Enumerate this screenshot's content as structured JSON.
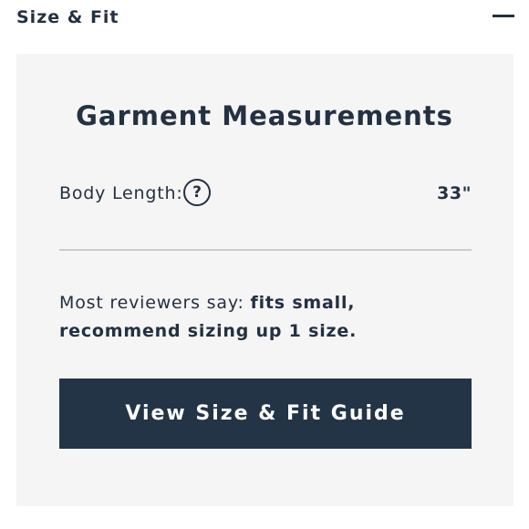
{
  "accordion": {
    "title": "Size & Fit",
    "toggle_icon": "minus-icon"
  },
  "panel": {
    "title": "Garment Measurements",
    "measurement": {
      "label": "Body Length:",
      "help_icon": "question-circle-icon",
      "help_glyph": "?",
      "value": "33\""
    },
    "reviews": {
      "prefix": "Most reviewers say: ",
      "verdict": "fits small, recommend sizing up 1 size."
    },
    "button_label": "View Size & Fit Guide"
  },
  "colors": {
    "text": "#233142",
    "panel_bg": "#f5f5f5",
    "button_bg": "#233447",
    "divider": "#cccccc"
  }
}
